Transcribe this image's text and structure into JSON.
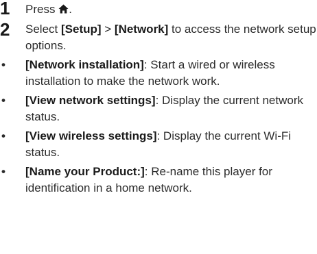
{
  "steps": [
    {
      "number": "1",
      "text_before": "Press ",
      "icon": "home-icon",
      "text_after": "."
    },
    {
      "number": "2",
      "text_before": "Select ",
      "bold1": "[Setup]",
      "middle": " > ",
      "bold2": "[Network]",
      "text_after": " to access the network setup options."
    }
  ],
  "bullets": [
    {
      "symbol": "•",
      "term": "[Network installation]",
      "description": ": Start a wired or wireless installation to make the network work."
    },
    {
      "symbol": "•",
      "term": "[View network settings]",
      "description": ": Display the current network status."
    },
    {
      "symbol": "•",
      "term": "[View wireless settings]",
      "description": ": Display the current Wi-Fi status."
    },
    {
      "symbol": "•",
      "term": "[Name your Product:]",
      "description": ": Re-name this player for identification in a home network."
    }
  ]
}
